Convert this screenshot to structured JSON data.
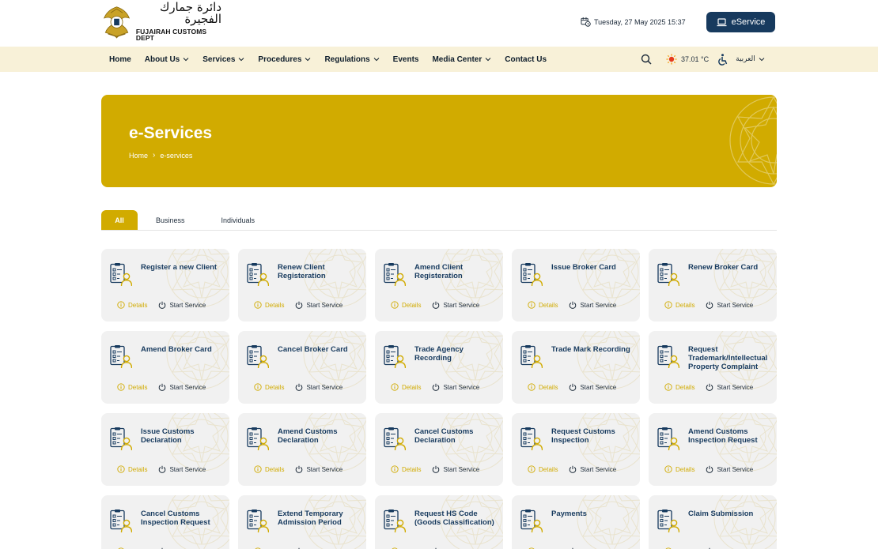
{
  "header": {
    "logo_ar": "دائرة جمارك الفجيرة",
    "logo_en": "FUJAIRAH CUSTOMS DEPT",
    "datetime": "Tuesday, 27 May 2025 15:37",
    "eservice_label": "eService"
  },
  "nav": {
    "items": [
      {
        "label": "Home",
        "dropdown": false
      },
      {
        "label": "About Us",
        "dropdown": true
      },
      {
        "label": "Services",
        "dropdown": true
      },
      {
        "label": "Procedures",
        "dropdown": true
      },
      {
        "label": "Regulations",
        "dropdown": true
      },
      {
        "label": "Events",
        "dropdown": false
      },
      {
        "label": "Media Center",
        "dropdown": true
      },
      {
        "label": "Contact Us",
        "dropdown": false
      }
    ],
    "temperature": "37.01 °C",
    "language": "العربية"
  },
  "banner": {
    "title": "e-Services",
    "breadcrumb": [
      "Home",
      "e-services"
    ]
  },
  "tabs": [
    {
      "label": "All",
      "active": true
    },
    {
      "label": "Business",
      "active": false
    },
    {
      "label": "Individuals",
      "active": false
    }
  ],
  "card_actions": {
    "details": "Details",
    "start": "Start Service"
  },
  "services": [
    "Register a new Client",
    "Renew Client Registeration",
    "Amend Client Registeration",
    "Issue Broker Card",
    "Renew Broker Card",
    "Amend Broker Card",
    "Cancel Broker Card",
    "Trade Agency Recording",
    "Trade Mark Recording",
    "Request Trademark/Intellectual Property Complaint",
    "Issue Customs Declaration",
    "Amend Customs Declaration",
    "Cancel Customs Declaration",
    "Request Customs Inspection",
    "Amend Customs Inspection Request",
    "Cancel Customs Inspection Request",
    "Extend Temporary Admission Period",
    "Request HS Code (Goods Classification)",
    "Payments",
    "Claim Submission"
  ],
  "colors": {
    "gold": "#d1ab00",
    "navy": "#173a5e",
    "nav_bg": "#f8f1d8",
    "card_bg": "#f1f1f1"
  }
}
